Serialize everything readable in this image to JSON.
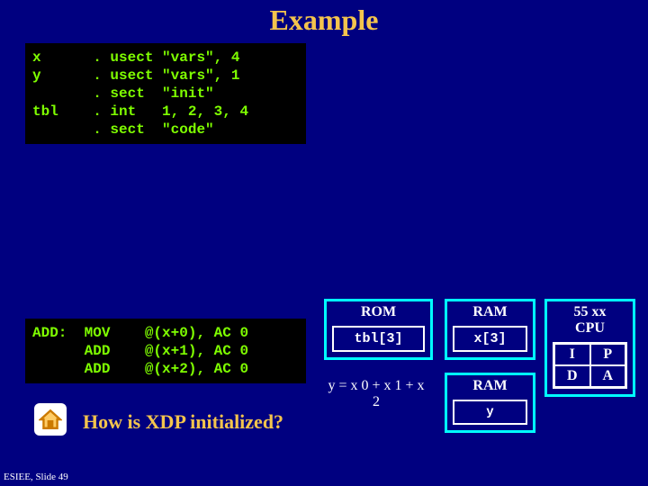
{
  "title": "Example",
  "code1": {
    "c0": {
      "l": "x",
      "d": ". usect",
      "a": "\"vars\", 4"
    },
    "c1": {
      "l": "y",
      "d": ". usect",
      "a": "\"vars\", 1"
    },
    "c2": {
      "l": "",
      "d": ". sect",
      "a": "\"init\""
    },
    "c3": {
      "l": "tbl",
      "d": ". int",
      "a": "1, 2, 3, 4"
    },
    "c4": {
      "l": "",
      "d": ". sect",
      "a": "\"code\""
    }
  },
  "code2": {
    "c0": {
      "l": "ADD:",
      "op": "MOV",
      "a": "@(x+0), AC 0"
    },
    "c1": {
      "l": "",
      "op": "ADD",
      "a": "@(x+1), AC 0"
    },
    "c2": {
      "l": "",
      "op": "ADD",
      "a": "@(x+2), AC 0"
    }
  },
  "rom": {
    "header": "ROM",
    "cell": "tbl[3]"
  },
  "ram": {
    "header": "RAM",
    "cell": "x[3]"
  },
  "cpu": {
    "header": "55 xx\nCPU",
    "g": {
      "a": "I",
      "b": "P",
      "c": "D",
      "d": "A"
    }
  },
  "eq": "y = x 0 + x 1 + x 2",
  "ram2": {
    "header": "RAM",
    "cell": "y"
  },
  "question": "How is XDP initialized?",
  "footer": "ESIEE, Slide 49"
}
